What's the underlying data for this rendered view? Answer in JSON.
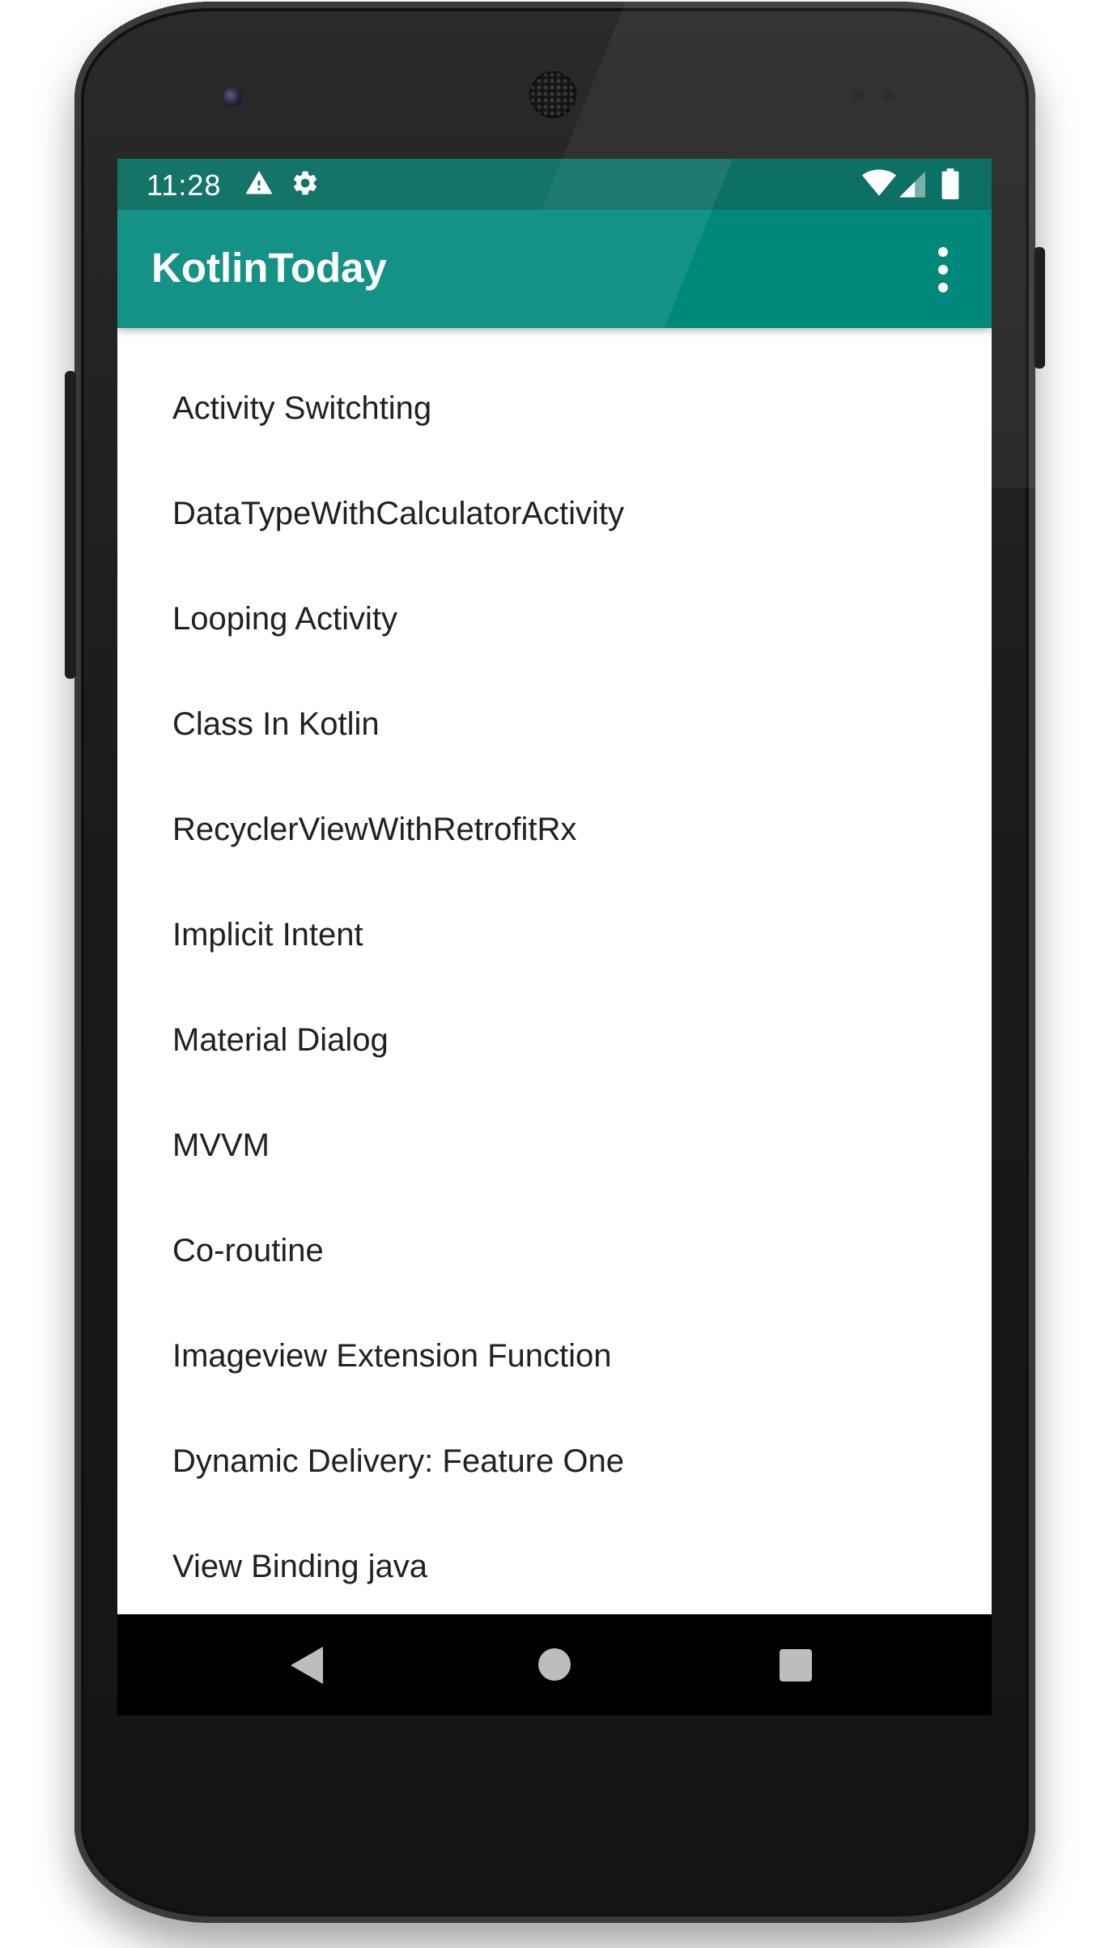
{
  "status_bar": {
    "time": "11:28",
    "icons": [
      "warning-icon",
      "settings-icon",
      "wifi-icon",
      "signal-icon",
      "battery-icon"
    ]
  },
  "app_bar": {
    "title": "KotlinToday",
    "menu_icon": "more-vert-icon"
  },
  "list": {
    "items": [
      "Activity Switchting",
      "DataTypeWithCalculatorActivity",
      "Looping Activity",
      "Class In Kotlin",
      "RecyclerViewWithRetrofitRx",
      "Implicit Intent",
      "Material Dialog",
      "MVVM",
      "Co-routine",
      "Imageview Extension Function",
      "Dynamic Delivery: Feature One",
      "View Binding java"
    ]
  },
  "nav_bar": {
    "buttons": [
      "back-icon",
      "home-icon",
      "recents-icon"
    ]
  },
  "colors": {
    "status_bar": "#00695c",
    "app_bar": "#00897b",
    "text": "#212121",
    "nav_bar": "#000000"
  }
}
